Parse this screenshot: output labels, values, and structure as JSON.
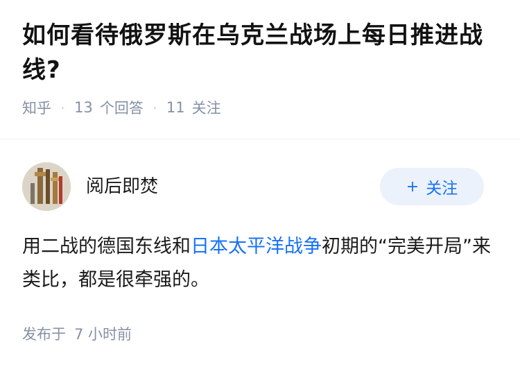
{
  "question": {
    "title": "如何看待俄罗斯在乌克兰战场上每日推进战线?",
    "source": "知乎",
    "answer_count": "13",
    "answer_label": "个回答",
    "follower_count": "11",
    "follower_label": "关注"
  },
  "answer": {
    "author_name": "阅后即焚",
    "follow_label": "关注",
    "follow_icon": "plus-icon",
    "content_before": "用二战的德国东线和",
    "content_link": "日本太平洋战争",
    "content_after": "初期的“完美开局”来类比，都是很牵强的。",
    "published_label": "发布于",
    "published_time": "7 小时前"
  },
  "colors": {
    "accent": "#1772f6",
    "follow_bg": "#ebf2fb",
    "meta_text": "#8590a6"
  }
}
